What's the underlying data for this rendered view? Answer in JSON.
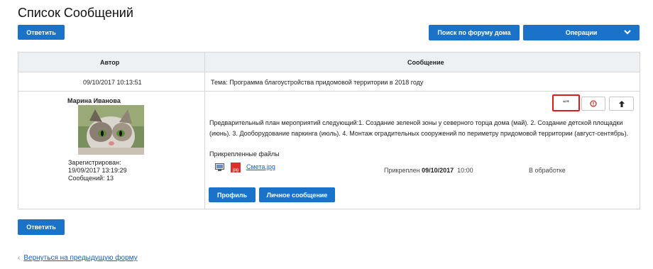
{
  "page": {
    "title": "Список Сообщений"
  },
  "toolbar": {
    "reply_label": "Ответить",
    "search_label": "Поиск по форуму дома",
    "operations_label": "Операции"
  },
  "table": {
    "headers": {
      "author": "Автор",
      "message": "Сообщение"
    },
    "topic_row": {
      "date": "09/10/2017 10:13:51",
      "topic": "Тема: Программа благоустройства придомовой территории в 2018 году"
    },
    "post": {
      "author_name": "Марина Иванова",
      "registered_label": "Зарегистрирован:",
      "registered_date": "19/09/2017 13:19:29",
      "messages_count": "Сообщений: 13",
      "body": "Предварительный план мероприятий следующий:1. Создание зеленой зоны у северного торца дома (май). 2. Создание детской площадки (июнь). 3. Дооборудование паркинга (июль). 4. Монтаж оградительных сооружений по периметру придомовой территории (август-сентябрь).",
      "attachments_label": "Прикрепленные файлы",
      "file_name": "Смета.jpg",
      "file_badge": "jpg",
      "attached_prefix": "Прикреплен",
      "attached_date": "09/10/2017",
      "attached_time": "10:00",
      "status": "В обработке",
      "profile_label": "Профиль",
      "pm_label": "Личное сообщение",
      "quote_glyph": "“”"
    }
  },
  "footer": {
    "reply_label": "Ответить",
    "back_label": "Вернуться на предыдущую форму"
  },
  "colors": {
    "accent": "#1a73c9",
    "highlight": "#e0191e",
    "header_bg": "#eef1f4"
  }
}
